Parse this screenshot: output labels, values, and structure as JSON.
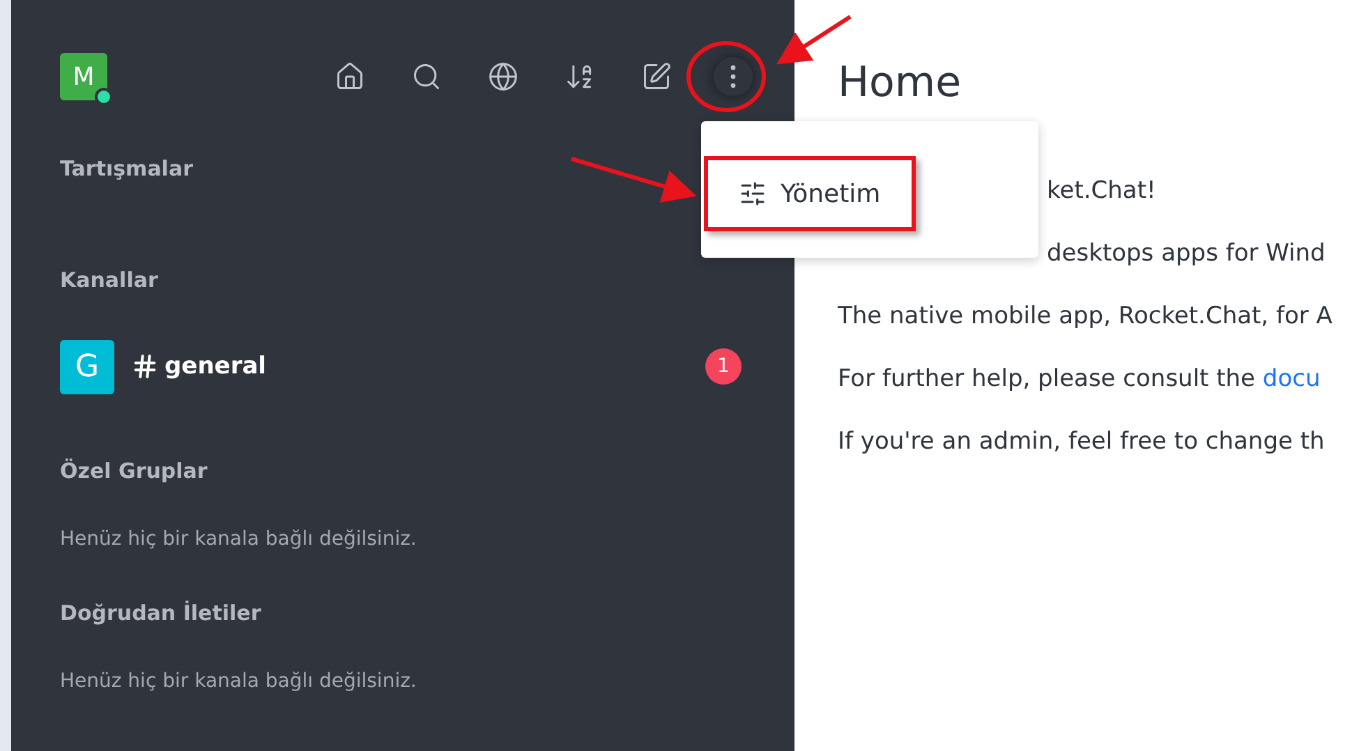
{
  "sidebar": {
    "user": {
      "initial": "M",
      "online": true
    },
    "toolbar": [
      {
        "kind": "home",
        "circled": false
      },
      {
        "kind": "search",
        "circled": false
      },
      {
        "kind": "directory",
        "circled": false
      },
      {
        "kind": "sort",
        "circled": false
      },
      {
        "kind": "create",
        "circled": false
      },
      {
        "kind": "more",
        "circled": true
      }
    ],
    "sections": [
      {
        "title": "Tartışmalar"
      },
      {
        "title": "Kanallar",
        "items": [
          {
            "initial": "G",
            "name": "general",
            "unread": "1",
            "color": "#00bcd4"
          }
        ]
      },
      {
        "title": "Özel Gruplar",
        "empty_text": "Henüz hiç bir kanala bağlı değilsiniz."
      },
      {
        "title": "Doğrudan İletiler",
        "empty_text": "Henüz hiç bir kanala bağlı değilsiniz."
      }
    ]
  },
  "menu": {
    "items": [
      {
        "label": "Yönetim",
        "highlighted": true
      }
    ]
  },
  "main": {
    "title": "Home",
    "paragraphs": [
      {
        "text": "ket.Chat!",
        "covered": true
      },
      {
        "text": "desktops apps for Wind",
        "covered": true
      },
      {
        "text": "The native mobile app, Rocket.Chat, for A",
        "covered": false
      },
      {
        "text": "For further help, please consult the ",
        "link": "docu",
        "covered": false
      },
      {
        "text": "If you're an admin, feel free to change th",
        "covered": false
      }
    ]
  }
}
